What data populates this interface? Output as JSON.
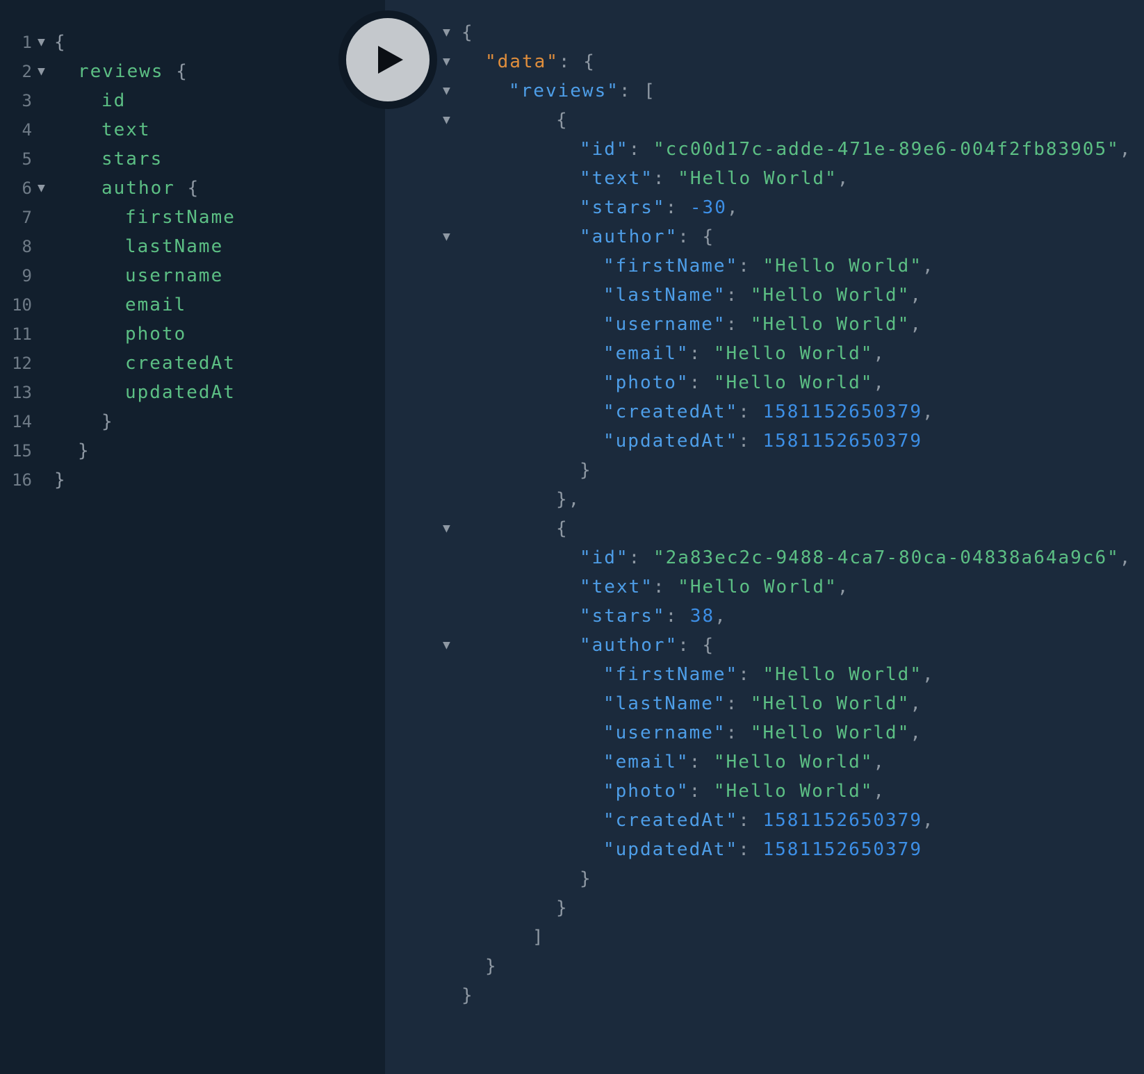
{
  "query": {
    "line_numbers": [
      "1",
      "2",
      "3",
      "4",
      "5",
      "6",
      "7",
      "8",
      "9",
      "10",
      "11",
      "12",
      "13",
      "14",
      "15",
      "16"
    ],
    "lines": [
      {
        "text": "{",
        "kind": "punct"
      },
      {
        "text": "reviews",
        "kind": "field",
        "suffix": " {"
      },
      {
        "text": "id",
        "kind": "field"
      },
      {
        "text": "text",
        "kind": "field"
      },
      {
        "text": "stars",
        "kind": "field"
      },
      {
        "text": "author",
        "kind": "field",
        "suffix": " {"
      },
      {
        "text": "firstName",
        "kind": "field"
      },
      {
        "text": "lastName",
        "kind": "field"
      },
      {
        "text": "username",
        "kind": "field"
      },
      {
        "text": "email",
        "kind": "field"
      },
      {
        "text": "photo",
        "kind": "field"
      },
      {
        "text": "createdAt",
        "kind": "field"
      },
      {
        "text": "updatedAt",
        "kind": "field"
      },
      {
        "text": "}",
        "kind": "punct"
      },
      {
        "text": "}",
        "kind": "punct"
      },
      {
        "text": "}",
        "kind": "punct"
      }
    ]
  },
  "result": {
    "review1": {
      "id": "\"cc00d17c-adde-471e-89e6-004f2fb83905\"",
      "text": "\"Hello World\"",
      "stars": "-30",
      "author": {
        "firstName": "\"Hello World\"",
        "lastName": "\"Hello World\"",
        "username": "\"Hello World\"",
        "email": "\"Hello World\"",
        "photo": "\"Hello World\"",
        "createdAt": "1581152650379",
        "updatedAt": "1581152650379"
      }
    },
    "review2": {
      "id": "\"2a83ec2c-9488-4ca7-80ca-04838a64a9c6\"",
      "text": "\"Hello World\"",
      "stars": "38",
      "author": {
        "firstName": "\"Hello World\"",
        "lastName": "\"Hello World\"",
        "username": "\"Hello World\"",
        "email": "\"Hello World\"",
        "photo": "\"Hello World\"",
        "createdAt": "1581152650379",
        "updatedAt": "1581152650379"
      }
    },
    "keys": {
      "data": "\"data\"",
      "reviews": "\"reviews\"",
      "id": "\"id\"",
      "text": "\"text\"",
      "stars": "\"stars\"",
      "author": "\"author\"",
      "firstName": "\"firstName\"",
      "lastName": "\"lastName\"",
      "username": "\"username\"",
      "email": "\"email\"",
      "photo": "\"photo\"",
      "createdAt": "\"createdAt\"",
      "updatedAt": "\"updatedAt\""
    }
  },
  "icons": {
    "play": "play-icon",
    "fold": "fold-arrow-icon",
    "fold_glyph": "▼"
  }
}
